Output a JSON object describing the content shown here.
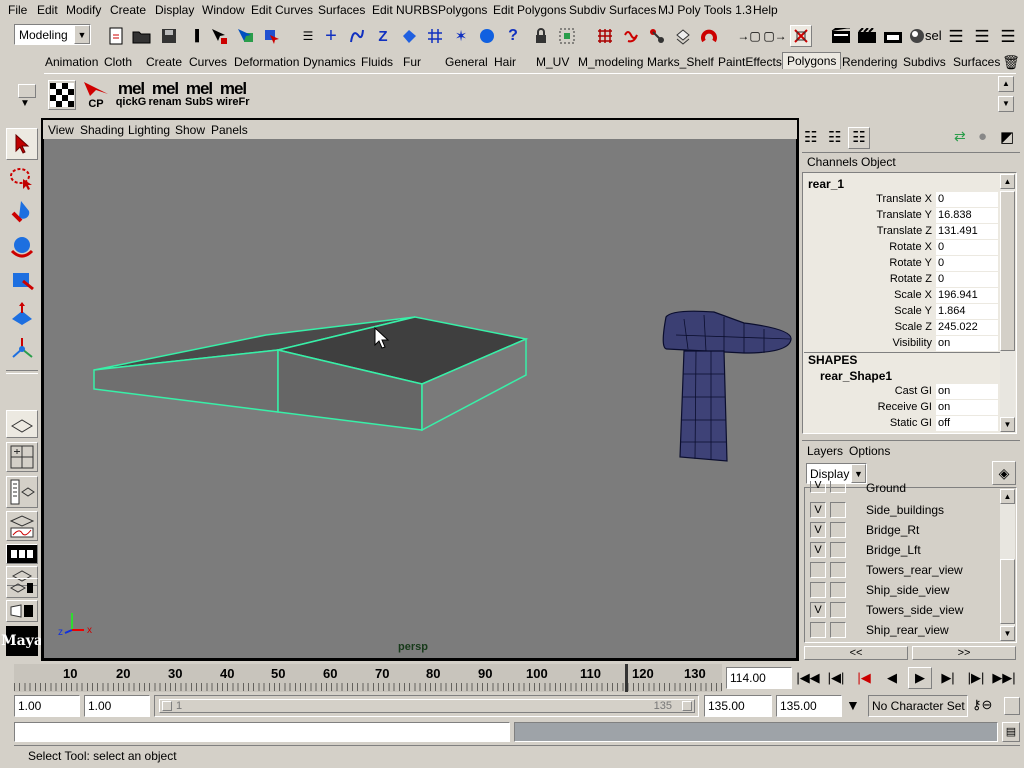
{
  "menubar": [
    "File",
    "Edit",
    "Modify",
    "Create",
    "Display",
    "Window",
    "Edit Curves",
    "Surfaces",
    "Edit NURBS",
    "Polygons",
    "Edit Polygons",
    "Subdiv Surfaces",
    "MJ Poly Tools 1.3",
    "Help"
  ],
  "statusline": {
    "menu_set": "Modeling",
    "sel_label": "sel"
  },
  "shelf_tabs": [
    "Animation",
    "Cloth",
    "Create",
    "Curves",
    "Deformation",
    "Dynamics",
    "Fluids",
    "Fur",
    "General",
    "Hair",
    "M_UV",
    "M_modeling",
    "Marks_Shelf",
    "PaintEffects",
    "Polygons",
    "Rendering",
    "Subdivs",
    "Surfaces"
  ],
  "shelf_active_tab": "Polygons",
  "shelf_buttons": [
    {
      "icon": "checker-icon",
      "label": ""
    },
    {
      "icon": "arrow-red-icon",
      "label": "CP"
    },
    {
      "icon": "mel-icon",
      "label": "qickG",
      "top": "mel"
    },
    {
      "icon": "mel-icon",
      "label": "renam",
      "top": "mel"
    },
    {
      "icon": "mel-icon",
      "label": "SubS",
      "top": "mel"
    },
    {
      "icon": "mel-icon",
      "label": "wireFr",
      "top": "mel"
    }
  ],
  "viewport": {
    "menu": [
      "View",
      "Shading",
      "Lighting",
      "Show",
      "Panels"
    ],
    "camera": "persp",
    "axis_x": "x",
    "axis_z": "z"
  },
  "channels": {
    "menu": [
      "Channels",
      "Object"
    ],
    "object": "rear_1",
    "attrs": [
      {
        "name": "Translate X",
        "value": "0"
      },
      {
        "name": "Translate Y",
        "value": "16.838"
      },
      {
        "name": "Translate Z",
        "value": "131.491"
      },
      {
        "name": "Rotate X",
        "value": "0"
      },
      {
        "name": "Rotate Y",
        "value": "0"
      },
      {
        "name": "Rotate Z",
        "value": "0"
      },
      {
        "name": "Scale X",
        "value": "196.941"
      },
      {
        "name": "Scale Y",
        "value": "1.864"
      },
      {
        "name": "Scale Z",
        "value": "245.022"
      },
      {
        "name": "Visibility",
        "value": "on"
      }
    ],
    "shapes_header": "SHAPES",
    "shape_name": "rear_Shape1",
    "shape_attrs": [
      {
        "name": "Cast GI",
        "value": "on"
      },
      {
        "name": "Receive GI",
        "value": "on"
      },
      {
        "name": "Static GI",
        "value": "off"
      }
    ]
  },
  "layers": {
    "menu": [
      "Layers",
      "Options"
    ],
    "mode": "Display",
    "rows": [
      {
        "v": "V",
        "name": "Ground"
      },
      {
        "v": "V",
        "name": "Side_buildings"
      },
      {
        "v": "V",
        "name": "Bridge_Rt"
      },
      {
        "v": "V",
        "name": "Bridge_Lft"
      },
      {
        "v": "",
        "name": "Towers_rear_view"
      },
      {
        "v": "",
        "name": "Ship_side_view"
      },
      {
        "v": "V",
        "name": "Towers_side_view"
      },
      {
        "v": "",
        "name": "Ship_rear_view"
      }
    ],
    "nav_left": "<<",
    "nav_right": ">>"
  },
  "timeline": {
    "ticks": [
      "10",
      "20",
      "30",
      "40",
      "50",
      "60",
      "70",
      "80",
      "90",
      "100",
      "110",
      "120",
      "130"
    ],
    "current_time": "114.00"
  },
  "range": {
    "start": "1.00",
    "playback_start": "1.00",
    "slider_left": "1",
    "slider_right": "135",
    "playback_end": "135.00",
    "end": "135.00",
    "character_set": "No Character Set"
  },
  "help_line": "Select Tool: select an object"
}
